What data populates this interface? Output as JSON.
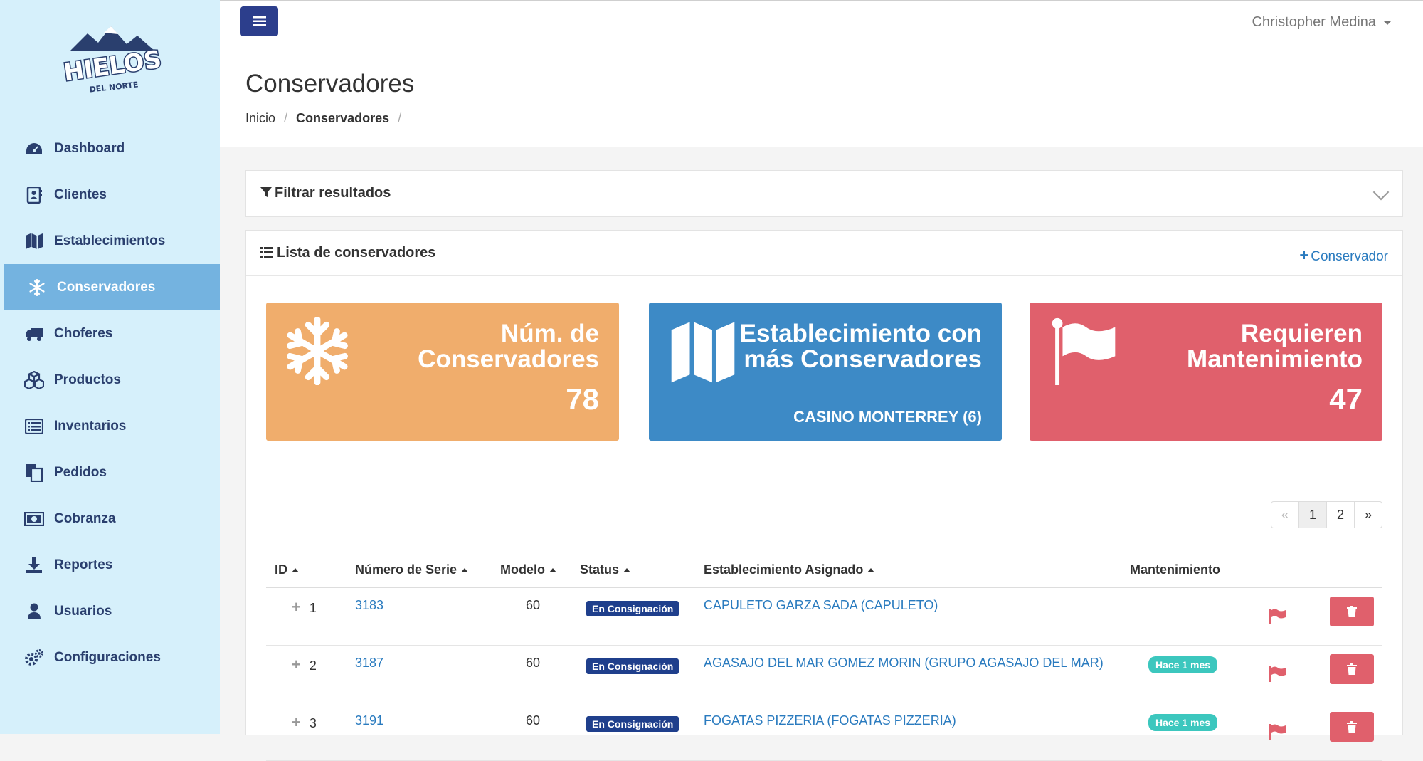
{
  "brand": {
    "logo_main": "HIELOS",
    "logo_sub": "DEL NORTE"
  },
  "user": {
    "name": "Christopher Medina"
  },
  "sidebar": {
    "items": [
      {
        "label": "Dashboard",
        "icon": "dashboard-icon"
      },
      {
        "label": "Clientes",
        "icon": "address-book-icon"
      },
      {
        "label": "Establecimientos",
        "icon": "map-icon"
      },
      {
        "label": "Conservadores",
        "icon": "snowflake-icon",
        "active": true
      },
      {
        "label": "Choferes",
        "icon": "truck-icon"
      },
      {
        "label": "Productos",
        "icon": "cubes-icon"
      },
      {
        "label": "Inventarios",
        "icon": "list-alt-icon"
      },
      {
        "label": "Pedidos",
        "icon": "files-icon"
      },
      {
        "label": "Cobranza",
        "icon": "money-icon"
      },
      {
        "label": "Reportes",
        "icon": "download-icon"
      },
      {
        "label": "Usuarios",
        "icon": "user-icon"
      },
      {
        "label": "Configuraciones",
        "icon": "gears-icon"
      }
    ]
  },
  "page": {
    "title": "Conservadores",
    "breadcrumb": {
      "home": "Inicio",
      "current": "Conservadores",
      "sep": "/"
    }
  },
  "filter": {
    "title": "Filtrar resultados"
  },
  "list": {
    "title": "Lista de conservadores",
    "add_label": "Conservador"
  },
  "cards": {
    "count": {
      "title_l1": "Núm. de",
      "title_l2": "Conservadores",
      "value": "78",
      "color": "#f0ad6c"
    },
    "top": {
      "title_l1": "Establecimiento con",
      "title_l2": "más Conservadores",
      "value": "CASINO MONTERREY (6)",
      "color": "#3d8ac6"
    },
    "maint": {
      "title_l1": "Requieren",
      "title_l2": "Mantenimiento",
      "value": "47",
      "color": "#e0606c"
    }
  },
  "pagination": {
    "prev": "«",
    "pages": [
      "1",
      "2"
    ],
    "next": "»",
    "current": "1"
  },
  "table": {
    "headers": {
      "id": "ID",
      "serie": "Número de Serie",
      "modelo": "Modelo",
      "status": "Status",
      "estab": "Establecimiento Asignado",
      "mant": "Mantenimiento"
    },
    "rows": [
      {
        "id": "1",
        "serie": "3183",
        "modelo": "60",
        "status": "En Consignación",
        "estab": "CAPULETO GARZA SADA (CAPULETO)",
        "mant": ""
      },
      {
        "id": "2",
        "serie": "3187",
        "modelo": "60",
        "status": "En Consignación",
        "estab": "AGASAJO DEL MAR GOMEZ MORIN (GRUPO AGASAJO DEL MAR)",
        "mant": "Hace 1 mes"
      },
      {
        "id": "3",
        "serie": "3191",
        "modelo": "60",
        "status": "En Consignación",
        "estab": "FOGATAS PIZZERIA (FOGATAS PIZZERIA)",
        "mant": "Hace 1 mes"
      }
    ]
  }
}
